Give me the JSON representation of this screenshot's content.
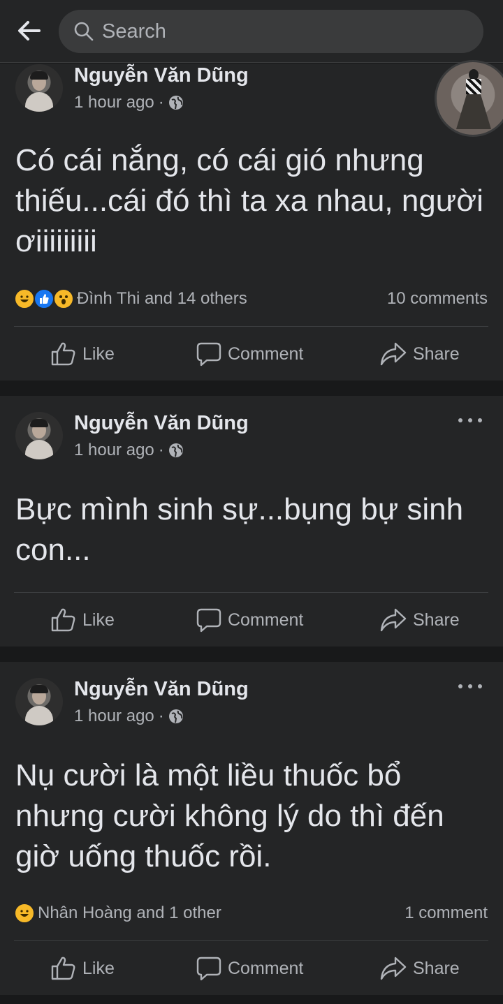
{
  "header": {
    "search_placeholder": "Search"
  },
  "posts": [
    {
      "author": "Nguyễn Văn Dũng",
      "time": "1 hour ago",
      "text": "Có cái nắng, có cái gió nhưng thiếu...cái đó thì ta xa nhau, người ơiiiiiiiii",
      "reactions": [
        "haha",
        "like",
        "wow"
      ],
      "reaction_summary": "Đình Thi and 14 others",
      "comments": "10 comments"
    },
    {
      "author": "Nguyễn Văn Dũng",
      "time": "1 hour ago",
      "text": "Bực mình sinh sự...bụng bự sinh con...",
      "reactions": [],
      "reaction_summary": "",
      "comments": ""
    },
    {
      "author": "Nguyễn Văn Dũng",
      "time": "1 hour ago",
      "text": "Nụ cười là một liều thuốc bổ nhưng cười không lý do thì đến giờ uống thuốc rồi.",
      "reactions": [
        "haha"
      ],
      "reaction_summary": "Nhân Hoàng and 1 other",
      "comments": "1 comment"
    }
  ],
  "actions": {
    "like": "Like",
    "comment": "Comment",
    "share": "Share"
  },
  "colors": {
    "background": "#18191a",
    "card": "#242526",
    "text_primary": "#e4e6eb",
    "text_secondary": "#b0b3b8",
    "like_blue": "#1877f2",
    "haha_yellow": "#f7b928"
  }
}
